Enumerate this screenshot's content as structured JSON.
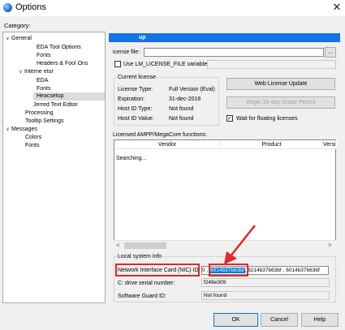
{
  "window": {
    "title": "Options",
    "close_glyph": "✕"
  },
  "category_label": "Category:",
  "tree": [
    {
      "label": "General",
      "exp": "∨"
    },
    {
      "label": "EDA Tool Options",
      "exp": ""
    },
    {
      "label": "Fonts",
      "exp": ""
    },
    {
      "label": "Headers & Fool Ons",
      "exp": ""
    },
    {
      "label": "Interne etur",
      "exp": "∨"
    },
    {
      "label": "EDA",
      "exp": ""
    },
    {
      "label": "Fonts",
      "exp": ""
    },
    {
      "label": "Heacsetup",
      "exp": "",
      "selected": true
    },
    {
      "label": "Jerred Text Editor",
      "exp": ""
    },
    {
      "label": "Processing",
      "exp": ""
    },
    {
      "label": "Tooltip Settings",
      "exp": ""
    },
    {
      "label": "Messages",
      "exp": "∨"
    },
    {
      "label": "Colors",
      "exp": ""
    },
    {
      "label": "Fonts",
      "exp": ""
    }
  ],
  "panel": {
    "header": "up",
    "license_file_label": "icense file:",
    "browse_label": "...",
    "use_env_label": "Use LM_LICENSE_FILE variable:",
    "current_license_title": "Current license",
    "license_rows": [
      {
        "label": "License Type:",
        "value": "Full Version (Eval)"
      },
      {
        "label": "Expiration:",
        "value": "31-dec-2018"
      },
      {
        "label": "Host ID Type:",
        "value": "Not found"
      },
      {
        "label": "Host ID Value:",
        "value": "Not found"
      }
    ],
    "web_license_btn": "Web License Update",
    "grace_period_btn": "Begin 30-day Grace Period",
    "wait_floating_label": "Wait for floating licenses",
    "wait_floating_checked": true,
    "licensed_functions_label": "Licensed AMPP/MegaCore functions:",
    "columns": [
      "Vendor",
      "Product",
      "Versi"
    ],
    "list_status": "Searching...",
    "local_info_title": "Local system info",
    "nic_label": "Network Interface Card (NIC) ID:",
    "nic_prefix": "0 ,",
    "nic_highlight": "6014b37b63bf",
    "nic_rest": ", 6214b37b63bf , 6014b37b63bf",
    "drive_label": "C: drive serial number:",
    "drive_value": "f248e309",
    "guard_label": "Software Guard ID:",
    "guard_value": "Not found"
  },
  "buttons": {
    "ok": "OK",
    "cancel": "Cancel",
    "help": "Help"
  },
  "colors": {
    "accent": "#1473e6",
    "annotation": "#e02828",
    "selection": "#0078d7"
  },
  "icons": [
    "options-app-icon",
    "close-icon",
    "check-icon",
    "arrow-annotation-icon"
  ]
}
